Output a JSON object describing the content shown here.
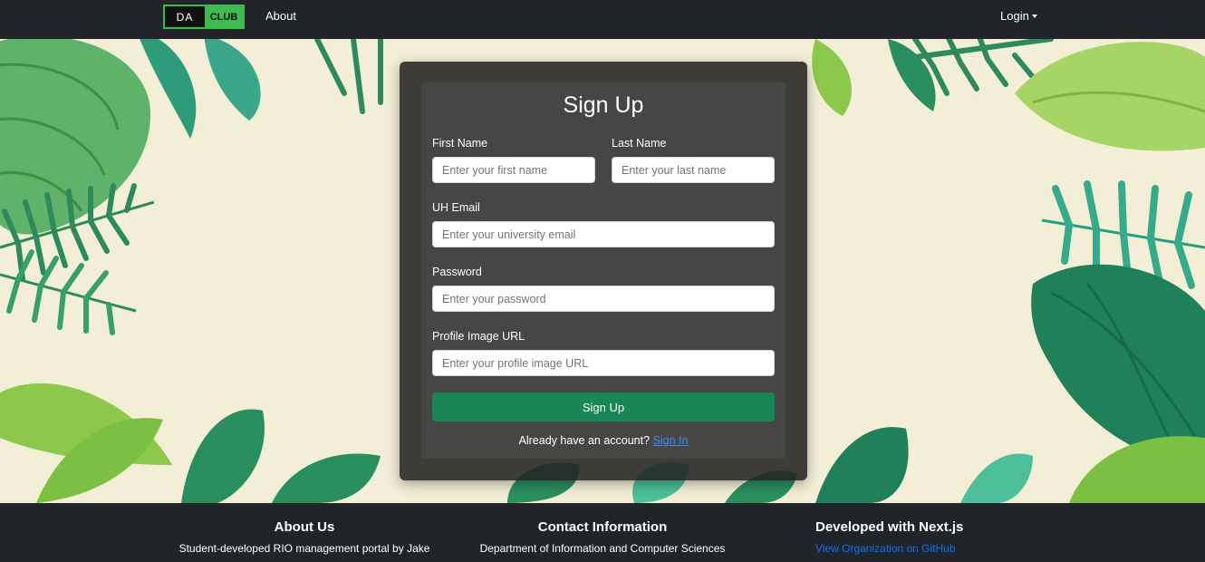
{
  "navbar": {
    "brand_left": "DA",
    "brand_right": "CLUB",
    "about": "About",
    "login": "Login"
  },
  "form": {
    "title": "Sign Up",
    "first_name_label": "First Name",
    "first_name_placeholder": "Enter your first name",
    "last_name_label": "Last Name",
    "last_name_placeholder": "Enter your last name",
    "email_label": "UH Email",
    "email_placeholder": "Enter your university email",
    "password_label": "Password",
    "password_placeholder": "Enter your password",
    "image_label": "Profile Image URL",
    "image_placeholder": "Enter your profile image URL",
    "submit": "Sign Up",
    "already_text": "Already have an account?",
    "sign_in_link": "Sign In"
  },
  "footer": {
    "about_title": "About Us",
    "about_text": "Student-developed RIO management portal by Jake",
    "contact_title": "Contact Information",
    "contact_text": "Department of Information and Computer Sciences",
    "dev_title": "Developed with Next.js",
    "dev_link": "View Organization on GitHub"
  },
  "colors": {
    "navbar": "#212529",
    "brand": "#3dbb4f",
    "button": "#198754",
    "link": "#0d6efd",
    "hero_background": "#f3efd6"
  }
}
